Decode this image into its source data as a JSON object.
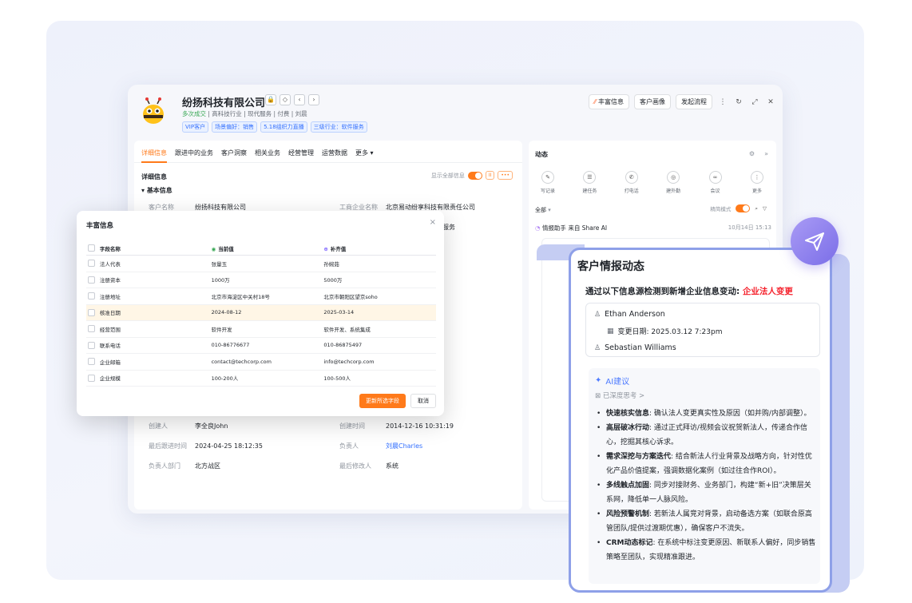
{
  "header": {
    "company": "纷扬科技有限公司",
    "meta_status": "多次成交",
    "meta_rest": " | 高科技行业 | 现代服务 | 付费 | 刘晨",
    "tags": [
      "VIP客户",
      "场景偏好：销售",
      "5.18组织力直播",
      "三级行业：软件服务"
    ],
    "buttons": {
      "enrich": "丰富信息",
      "enrich_prefix": "⁄⁄",
      "portrait": "客户画像",
      "flow": "发起流程"
    }
  },
  "tabs": [
    "详细信息",
    "跟进中的业务",
    "客户洞察",
    "相关业务",
    "经营管理",
    "运营数据",
    "更多"
  ],
  "detail": {
    "section": "详细信息",
    "show_all": "显示全部信息",
    "basic": "基本信息",
    "partial_top_left_key": "客户名称",
    "partial_top_left_val": "纷扬科技有限公司",
    "partial_top_right_key": "工商企业名称",
    "partial_top_right_val": "北京易动纷享科技有限责任公司",
    "partial_row2_right": "服务",
    "rows": [
      {
        "k1": "创建人",
        "v1": "李全良John",
        "k2": "创建时间",
        "v2": "2014-12-16 10:31:19"
      },
      {
        "k1": "最后跟进时间",
        "v1": "2024-04-25 18:12:35",
        "k2": "负责人",
        "v2": "刘晨Charles"
      },
      {
        "k1": "负责人部门",
        "v1": "北方战区",
        "k2": "最后修改人",
        "v2": "系统"
      }
    ]
  },
  "popup": {
    "title": "丰富信息",
    "columns": [
      "字段名称",
      "当前值",
      "补齐值"
    ],
    "rows": [
      [
        "法人代表",
        "张量玉",
        "孙婉茹"
      ],
      [
        "注册资本",
        "1000万",
        "5000万"
      ],
      [
        "注册地址",
        "北京市海淀区中关村18号",
        "北京市朝阳区望京soho"
      ],
      [
        "核准日期",
        "2024-08-12",
        "2025-03-14"
      ],
      [
        "经营范围",
        "软件开发",
        "软件开发、系统集成"
      ],
      [
        "联系电话",
        "010-86776677",
        "010-86875497"
      ],
      [
        "企业邮箱",
        "contact@techcorp.com",
        "info@techcorp.com"
      ],
      [
        "企业规模",
        "100-200人",
        "100-500人"
      ]
    ],
    "highlight_row": 3,
    "primary_btn": "更新所选字段",
    "cancel_btn": "取消"
  },
  "dynamics": {
    "title": "动态",
    "actions": [
      "写记录",
      "建任务",
      "打电话",
      "建外勤",
      "会议",
      "更多"
    ],
    "filter": "全部",
    "mode": "精简模式",
    "feed_head": "情报助手 来自 Share AI",
    "feed_date": "10月14日 15:13"
  },
  "ai": {
    "title": "客户情报动态",
    "subtitle": "通过以下信息源检测到新增企业信息变动: ",
    "subtitle_highlight": "企业法人变更",
    "person1": "Ethan Anderson",
    "change_date": "变更日期: 2025.03.12 7:23pm",
    "person2": "Sebastian Williams",
    "suggest_title": "AI建议",
    "deep_think": "已深度思考 >",
    "items": [
      {
        "b": "快速核实信息",
        "t": ": 确认法人变更真实性及原因（如并购/内部调整）。"
      },
      {
        "b": "高层破冰行动",
        "t": ": 通过正式拜访/视频会议祝贺新法人，传递合作信心，挖掘其核心诉求。"
      },
      {
        "b": "需求深挖与方案迭代",
        "t": ": 结合新法人行业背景及战略方向，针对性优化产品价值提案，强调数据化案例（如过往合作ROI）。"
      },
      {
        "b": "多线触点加固",
        "t": ": 同步对接财务、业务部门，构建“新+旧”决策层关系网，降低单一人脉风险。"
      },
      {
        "b": "风险预警机制",
        "t": ": 若新法人属竞对背景，启动备选方案（如联合原高管团队/提供过渡期优惠），确保客户不流失。"
      },
      {
        "b": "CRM动态标记",
        "t": ": 在系统中标注变更原因、新联系人偏好，同步销售策略至团队，实现精准跟进。"
      }
    ]
  },
  "colors": {
    "accent": "#ff7a1a",
    "link": "#3370ff",
    "alert": "#f5222d",
    "ai_border": "#8ea0e8"
  }
}
